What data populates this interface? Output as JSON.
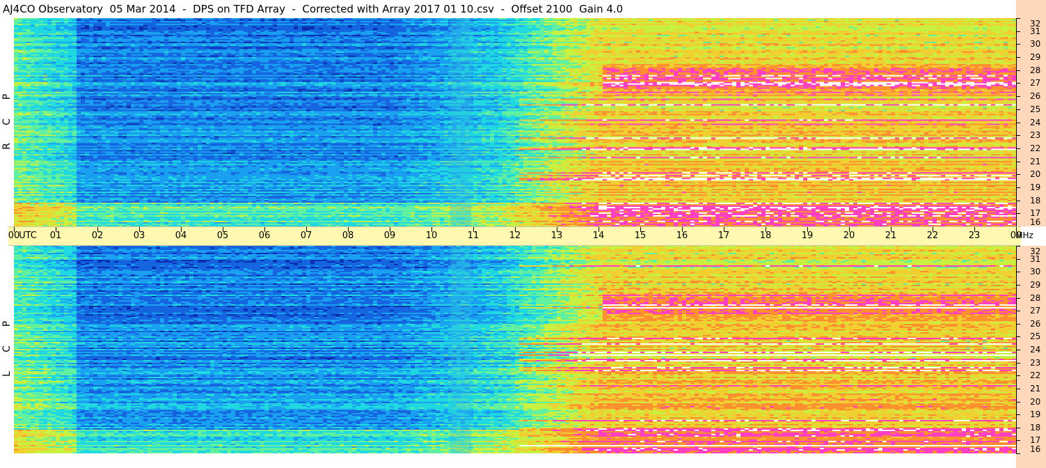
{
  "title": "AJ4CO Observatory  05 Mar 2014  -  DPS on TFD Array  -  Corrected with Array 2017 01 10.csv  -  Offset 2100  Gain 4.0",
  "chart_data": [
    {
      "type": "heatmap",
      "panel": "top",
      "side_label": [
        "R",
        "C",
        "P"
      ],
      "x_unit_label": "UTC",
      "x_ticks": [
        "00",
        "01",
        "02",
        "03",
        "04",
        "05",
        "06",
        "07",
        "08",
        "09",
        "10",
        "11",
        "12",
        "13",
        "14",
        "15",
        "16",
        "17",
        "18",
        "19",
        "20",
        "21",
        "22",
        "23",
        "00"
      ],
      "y_unit_label": "MHz",
      "y_ticks": [
        "16",
        "17",
        "18",
        "19",
        "20",
        "21",
        "22",
        "23",
        "24",
        "25",
        "26",
        "27",
        "28",
        "29",
        "30",
        "31",
        "32"
      ],
      "xlim_hours": [
        0,
        24
      ],
      "ylim_mhz": [
        16,
        32
      ],
      "colormap": [
        "#0a2fb0",
        "#1565e0",
        "#1aa0f0",
        "#20d8e0",
        "#60f0a0",
        "#c8f040",
        "#f0d030",
        "#ff9030",
        "#ff40c0",
        "#ffffff"
      ]
    },
    {
      "type": "heatmap",
      "panel": "bottom",
      "side_label": [
        "L",
        "C",
        "P"
      ],
      "y_unit_label": "",
      "y_ticks": [
        "16",
        "17",
        "18",
        "19",
        "20",
        "21",
        "22",
        "23",
        "24",
        "25",
        "26",
        "27",
        "28",
        "29",
        "30",
        "31",
        "32"
      ],
      "xlim_hours": [
        0,
        24
      ],
      "ylim_mhz": [
        16,
        32
      ]
    }
  ]
}
